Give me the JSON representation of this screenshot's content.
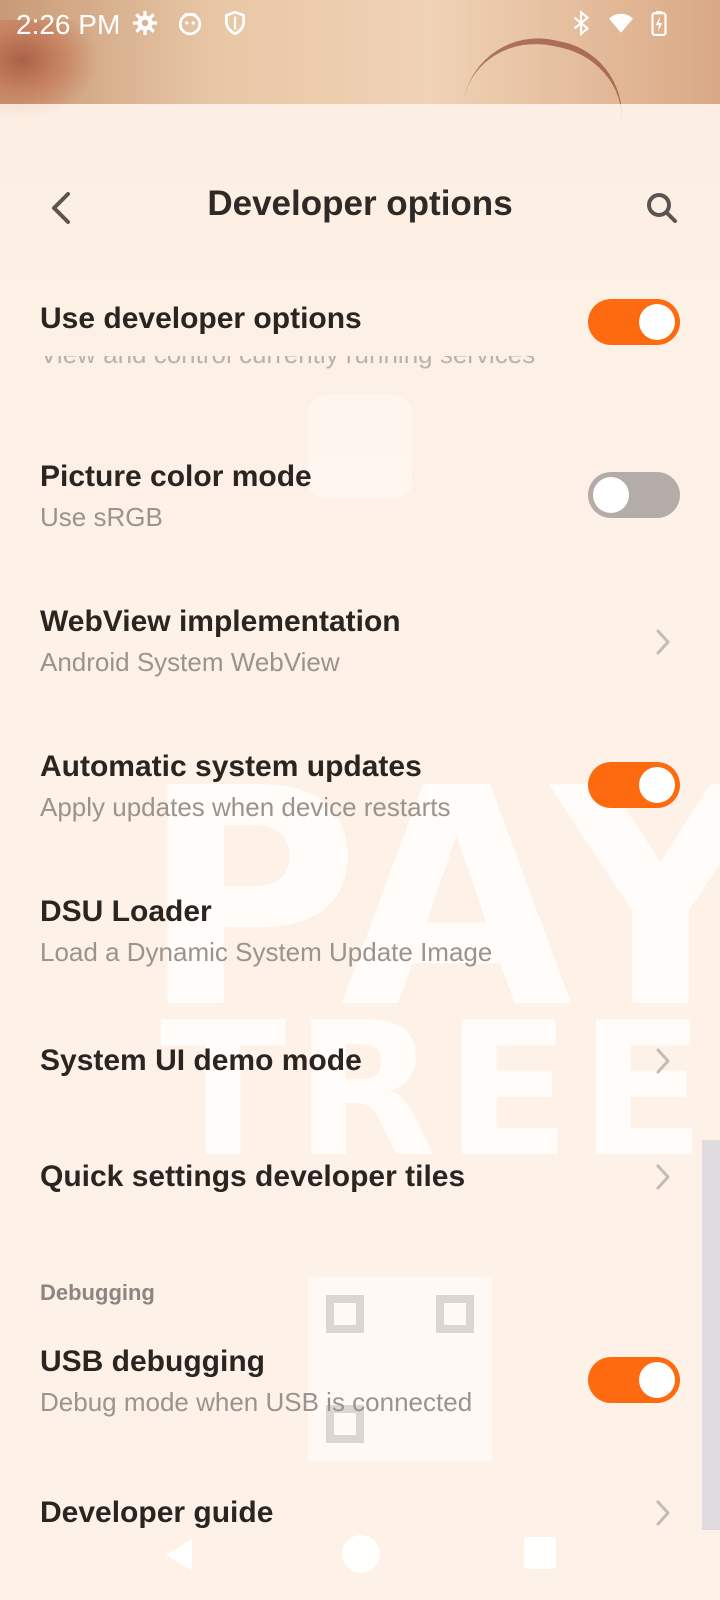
{
  "status_bar": {
    "time": "2:26 PM"
  },
  "toolbar": {
    "title": "Developer options"
  },
  "settings": [
    {
      "title": "Use developer options",
      "summary": "",
      "control": "toggle",
      "on": true
    },
    {
      "title": "Picture color mode",
      "summary": "Use sRGB",
      "control": "toggle",
      "on": false
    },
    {
      "title": "WebView implementation",
      "summary": "Android System WebView",
      "control": "chevron"
    },
    {
      "title": "Automatic system updates",
      "summary": "Apply updates when device restarts",
      "control": "toggle",
      "on": true
    },
    {
      "title": "DSU Loader",
      "summary": "Load a Dynamic System Update Image",
      "control": "none"
    },
    {
      "title": "System UI demo mode",
      "summary": "",
      "control": "chevron"
    },
    {
      "title": "Quick settings developer tiles",
      "summary": "",
      "control": "chevron"
    },
    {
      "title": "USB debugging",
      "summary": "Debug mode when USB is connected",
      "control": "toggle",
      "on": true
    },
    {
      "title": "Developer guide",
      "summary": "",
      "control": "chevron"
    }
  ],
  "partial_text": "View and control currently running services",
  "section_debugging": "Debugging",
  "colors": {
    "accent": "#fd6a10",
    "toggle_off": "#b4aca8"
  },
  "icons": {
    "back": "arrow-left-icon",
    "search": "search-icon"
  }
}
